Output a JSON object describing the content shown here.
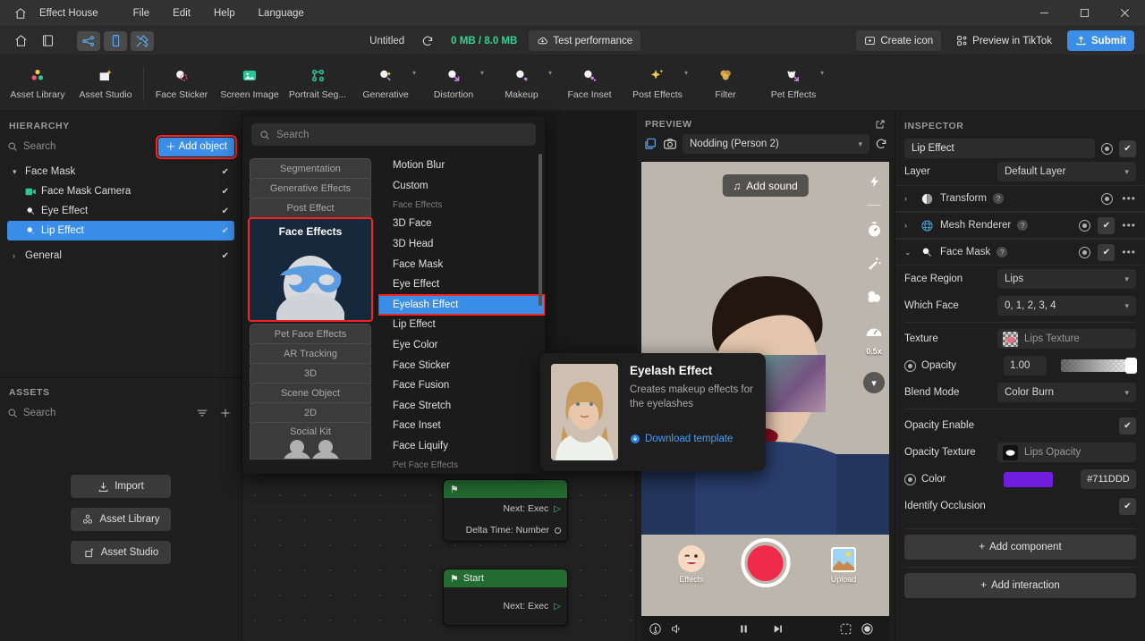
{
  "titlebar": {
    "brand": "Effect House",
    "menus": [
      "File",
      "Edit",
      "Help",
      "Language"
    ],
    "home_icon": "home-icon",
    "minimize": "–",
    "maximize": "□",
    "close": "✕"
  },
  "toolbar": {
    "icons": [
      "home-icon",
      "book-icon",
      "node-graph-icon",
      "phone-preview-icon",
      "tools-icon"
    ],
    "doc_title": "Untitled",
    "refresh_icon": "refresh-icon",
    "memory": "0 MB / 8.0 MB",
    "test_performance": "Test performance",
    "create_icon": "Create icon",
    "preview_tiktok": "Preview in TikTok",
    "submit": "Submit",
    "accent": "#3b8ee8",
    "memory_color": "#2fd58d"
  },
  "effectbar": {
    "items": [
      {
        "label": "Asset Library",
        "icon": "asset-library-icon",
        "caret": false
      },
      {
        "label": "Asset Studio",
        "icon": "asset-studio-icon",
        "caret": false
      },
      {
        "label": "Face Sticker",
        "icon": "face-sticker-icon",
        "caret": false
      },
      {
        "label": "Screen Image",
        "icon": "screen-image-icon",
        "caret": false
      },
      {
        "label": "Portrait Seg...",
        "icon": "portrait-segmentation-icon",
        "caret": false
      },
      {
        "label": "Generative",
        "icon": "generative-icon",
        "caret": true
      },
      {
        "label": "Distortion",
        "icon": "distortion-icon",
        "caret": true
      },
      {
        "label": "Makeup",
        "icon": "makeup-icon",
        "caret": true
      },
      {
        "label": "Face Inset",
        "icon": "face-inset-icon",
        "caret": false
      },
      {
        "label": "Post Effects",
        "icon": "post-effects-icon",
        "caret": true
      },
      {
        "label": "Filter",
        "icon": "filter-icon",
        "caret": false
      },
      {
        "label": "Pet Effects",
        "icon": "pet-effects-icon",
        "caret": true
      }
    ]
  },
  "hierarchy": {
    "title": "HIERARCHY",
    "search_placeholder": "Search",
    "add_object": "Add object",
    "nodes": [
      {
        "label": "Face Mask",
        "depth": 0,
        "arrow": "▾",
        "icon": "",
        "checked": true,
        "selected": false
      },
      {
        "label": "Face Mask Camera",
        "depth": 1,
        "arrow": "",
        "icon": "camera-icon",
        "checked": true,
        "selected": false
      },
      {
        "label": "Eye Effect",
        "depth": 1,
        "arrow": "",
        "icon": "face-mask-icon",
        "checked": true,
        "selected": false
      },
      {
        "label": "Lip Effect",
        "depth": 1,
        "arrow": "",
        "icon": "face-mask-icon",
        "checked": true,
        "selected": true
      },
      {
        "label": "General",
        "depth": 0,
        "arrow": "›",
        "icon": "",
        "checked": true,
        "selected": false
      }
    ]
  },
  "assets": {
    "title": "ASSETS",
    "search_placeholder": "Search",
    "filter_icon": "filter-lines-icon",
    "add_icon": "plus-icon",
    "buttons": [
      {
        "label": "Import",
        "icon": "import-icon"
      },
      {
        "label": "Asset Library",
        "icon": "asset-library-icon"
      },
      {
        "label": "Asset Studio",
        "icon": "asset-studio-icon"
      }
    ]
  },
  "dropdown": {
    "search_placeholder": "Search",
    "categories": [
      {
        "label": "Segmentation",
        "active": false
      },
      {
        "label": "Generative Effects",
        "active": false
      },
      {
        "label": "Post Effect",
        "active": false
      },
      {
        "label": "Face Effects",
        "active": true
      },
      {
        "label": "Pet Face Effects",
        "active": false
      },
      {
        "label": "AR Tracking",
        "active": false
      },
      {
        "label": "3D",
        "active": false
      },
      {
        "label": "Scene Object",
        "active": false
      },
      {
        "label": "2D",
        "active": false
      },
      {
        "label": "Social Kit",
        "active": false
      }
    ],
    "items": [
      {
        "label": "Motion Blur",
        "type": "item",
        "selected": false
      },
      {
        "label": "Custom",
        "type": "item",
        "selected": false
      },
      {
        "label": "Face Effects",
        "type": "header",
        "selected": false
      },
      {
        "label": "3D Face",
        "type": "item",
        "selected": false
      },
      {
        "label": "3D Head",
        "type": "item",
        "selected": false
      },
      {
        "label": "Face Mask",
        "type": "item",
        "selected": false
      },
      {
        "label": "Eye Effect",
        "type": "item",
        "selected": false
      },
      {
        "label": "Eyelash Effect",
        "type": "item",
        "selected": true
      },
      {
        "label": "Lip Effect",
        "type": "item",
        "selected": false
      },
      {
        "label": "Eye Color",
        "type": "item",
        "selected": false
      },
      {
        "label": "Face Sticker",
        "type": "item",
        "selected": false
      },
      {
        "label": "Face Fusion",
        "type": "item",
        "selected": false
      },
      {
        "label": "Face Stretch",
        "type": "item",
        "selected": false
      },
      {
        "label": "Face Inset",
        "type": "item",
        "selected": false
      },
      {
        "label": "Face Liquify",
        "type": "item",
        "selected": false
      },
      {
        "label": "Pet Face Effects",
        "type": "header",
        "selected": false
      }
    ]
  },
  "tooltip": {
    "title": "Eyelash Effect",
    "description": "Creates makeup effects for the eyelashes",
    "link": "Download template",
    "link_icon": "download-circle-icon"
  },
  "graph": {
    "info_icon": "info-icon",
    "folder_icon": "folder-icon",
    "popout_icon": "popout-icon",
    "close_icon": "close-icon",
    "nodes": [
      {
        "title": "",
        "rows": [
          "Next: Exec",
          "Delta Time: Number"
        ]
      },
      {
        "title": "Start",
        "rows": [
          "Next: Exec"
        ]
      }
    ]
  },
  "preview": {
    "title": "PREVIEW",
    "popout_icon": "popout-icon",
    "layers_icon": "layers-icon",
    "camera_icon": "camera-icon",
    "scene": "Nodding (Person 2)",
    "refresh_icon": "refresh-icon",
    "add_sound": "Add sound",
    "side_icons": [
      "flash-icon",
      "timer-icon",
      "magic-wand-icon",
      "filter-icon",
      "speed-icon",
      "chevron-down-icon"
    ],
    "speed": "0.5x",
    "effects_label": "Effects",
    "upload_label": "Upload",
    "bar_icons": [
      "tiktok-note-icon",
      "volume-icon",
      "pause-icon",
      "step-forward-icon",
      "screenshot-icon",
      "record-icon"
    ]
  },
  "inspector": {
    "title": "INSPECTOR",
    "object_name": "Lip Effect",
    "layer_label": "Layer",
    "layer_value": "Default Layer",
    "components": [
      {
        "name": "Transform",
        "expanded": false,
        "has_check": false
      },
      {
        "name": "Mesh Renderer",
        "expanded": false,
        "has_check": true
      },
      {
        "name": "Face Mask",
        "expanded": true,
        "has_check": true
      }
    ],
    "fields": {
      "face_region_label": "Face Region",
      "face_region_value": "Lips",
      "which_face_label": "Which Face",
      "which_face_value": "0, 1, 2, 3, 4",
      "texture_label": "Texture",
      "texture_value": "Lips Texture",
      "opacity_label": "Opacity",
      "opacity_value": "1.00",
      "blend_label": "Blend Mode",
      "blend_value": "Color Burn",
      "opacity_enable_label": "Opacity Enable",
      "opacity_texture_label": "Opacity Texture",
      "opacity_texture_value": "Lips Opacity",
      "color_label": "Color",
      "color_hex": "#711DDD",
      "identify_occlusion_label": "Identify Occlusion"
    },
    "add_component": "Add component",
    "add_interaction": "Add interaction"
  }
}
